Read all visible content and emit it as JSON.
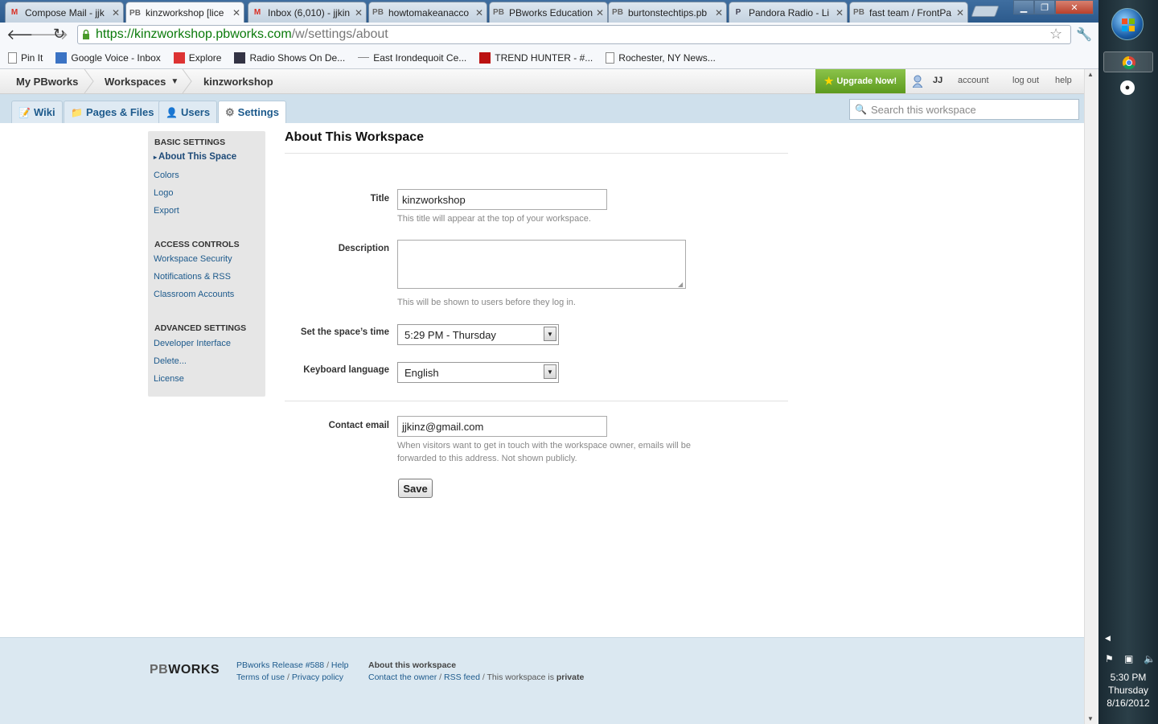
{
  "browser": {
    "tabs": [
      {
        "label": "Compose Mail - jjk",
        "icon": "gmail-icon"
      },
      {
        "label": "kinzworkshop [lice",
        "icon": "pbworks-icon",
        "active": true
      },
      {
        "label": "Inbox (6,010) - jjkin",
        "icon": "gmail-icon"
      },
      {
        "label": "howtomakeanacco",
        "icon": "pbworks-icon"
      },
      {
        "label": "PBworks Education",
        "icon": "pbworks-icon"
      },
      {
        "label": "burtonstechtips.pb",
        "icon": "pbworks-icon"
      },
      {
        "label": "Pandora Radio - Li",
        "icon": "pandora-icon"
      },
      {
        "label": "fast team / FrontPa",
        "icon": "pbworks-icon"
      }
    ],
    "url_domain": "https://kinzworkshop.pbworks.com",
    "url_path": "/w/settings/about",
    "bookmarks": [
      {
        "label": "Pin It",
        "icon": "page-icon"
      },
      {
        "label": "Google Voice - Inbox",
        "icon": "phone-icon"
      },
      {
        "label": "Explore",
        "icon": "explore-icon"
      },
      {
        "label": "Radio Shows On De...",
        "icon": "radio-icon"
      },
      {
        "label": "East Irondequoit Ce...",
        "icon": "dash-icon"
      },
      {
        "label": "TREND HUNTER - #...",
        "icon": "trend-icon"
      },
      {
        "label": "Rochester, NY News...",
        "icon": "page-icon"
      }
    ]
  },
  "pb": {
    "my_pbworks": "My PBworks",
    "workspaces": "Workspaces",
    "workspace_name": "kinzworkshop",
    "upgrade": "Upgrade Now!",
    "user": "JJ",
    "account": "account",
    "logout": "log out",
    "help": "help",
    "nav_tabs": [
      {
        "label": "Wiki",
        "icon": "wiki-icon"
      },
      {
        "label": "Pages & Files",
        "icon": "folder-icon"
      },
      {
        "label": "Users",
        "icon": "user-icon"
      },
      {
        "label": "Settings",
        "icon": "gear-icon",
        "active": true
      }
    ],
    "search_placeholder": "Search this workspace"
  },
  "sidebar": {
    "basic_heading": "BASIC SETTINGS",
    "basic": [
      "About This Space",
      "Colors",
      "Logo",
      "Export"
    ],
    "access_heading": "ACCESS CONTROLS",
    "access": [
      "Workspace Security",
      "Notifications & RSS",
      "Classroom Accounts"
    ],
    "advanced_heading": "ADVANCED SETTINGS",
    "advanced": [
      "Developer Interface",
      "Delete...",
      "License"
    ]
  },
  "form": {
    "page_title": "About This Workspace",
    "title_label": "Title",
    "title_value": "kinzworkshop",
    "title_hint": "This title will appear at the top of your workspace.",
    "description_label": "Description",
    "description_value": "",
    "description_hint": "This will be shown to users before they log in.",
    "time_label": "Set the space’s time",
    "time_value": "5:29 PM - Thursday",
    "keyboard_label": "Keyboard language",
    "keyboard_value": "English",
    "email_label": "Contact email",
    "email_value": "jjkinz@gmail.com",
    "email_hint_1": "When visitors want to get in touch with the workspace owner, emails will be",
    "email_hint_2": "forwarded to this address. Not shown publicly.",
    "save": "Save"
  },
  "footer": {
    "logo_pb": "PB",
    "logo_works": "WORKS",
    "release": "PBworks Release #588",
    "slash": "/",
    "help": "Help",
    "terms": "Terms of use",
    "privacy": "Privacy policy",
    "about": "About this workspace",
    "contact": "Contact the owner",
    "rss": "RSS feed",
    "private_text": "This workspace is",
    "private_word": "private"
  },
  "taskbar": {
    "time": "5:30 PM",
    "day": "Thursday",
    "date": "8/16/2012"
  }
}
